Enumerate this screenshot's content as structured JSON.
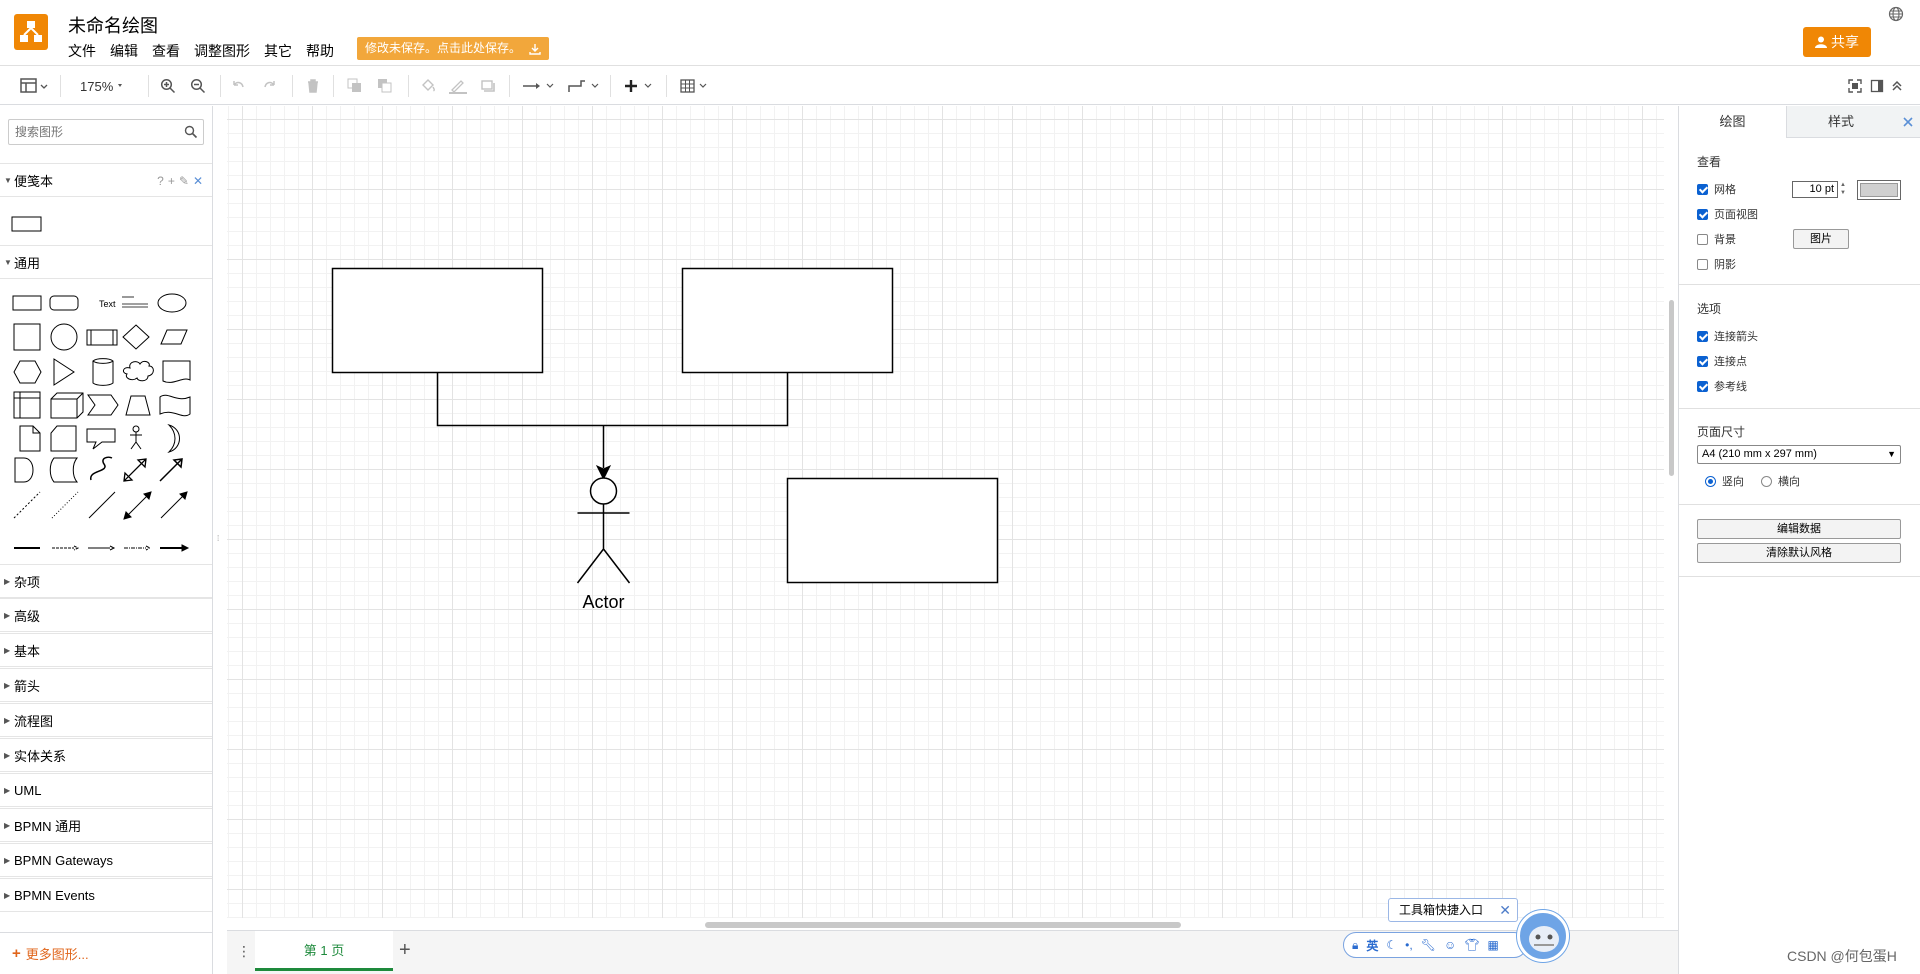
{
  "header": {
    "title": "未命名绘图",
    "menus": [
      "文件",
      "编辑",
      "查看",
      "调整图形",
      "其它",
      "帮助"
    ],
    "save_banner": "修改未保存。点击此处保存。",
    "share_label": "共享"
  },
  "toolbar": {
    "zoom": "175%"
  },
  "sidebar": {
    "search_placeholder": "搜索图形",
    "scratchpad_title": "便笺本",
    "general_title": "通用",
    "text_shape_label": "Text",
    "sections": [
      "杂项",
      "高级",
      "基本",
      "箭头",
      "流程图",
      "实体关系",
      "UML",
      "BPMN 通用",
      "BPMN Gateways",
      "BPMN Events"
    ],
    "more_shapes": "更多图形..."
  },
  "canvas": {
    "actor_label": "Actor"
  },
  "page_tabs": {
    "page1": "第 1 页"
  },
  "panel": {
    "tabs": [
      "绘图",
      "样式"
    ],
    "view_title": "查看",
    "grid_label": "网格",
    "grid_size": "10 pt",
    "page_view_label": "页面视图",
    "background_label": "背景",
    "image_button": "图片",
    "shadow_label": "阴影",
    "options_title": "选项",
    "connection_arrows": "连接箭头",
    "connection_points": "连接点",
    "guides": "参考线",
    "page_size_title": "页面尺寸",
    "page_size": "A4 (210 mm x 297 mm)",
    "portrait": "竖向",
    "landscape": "横向",
    "edit_data": "编辑数据",
    "clear_default_style": "清除默认风格",
    "grid_color": "#d0d0d0"
  },
  "toolbox": {
    "label": "工具箱快捷入口",
    "ime_label": "英"
  },
  "watermark": "CSDN @何包蛋H",
  "colors": {
    "brand": "#f08705",
    "save_banner": "#f2a73b",
    "active_tab": "#1e8a3c",
    "more_shapes": "#e0651b"
  }
}
